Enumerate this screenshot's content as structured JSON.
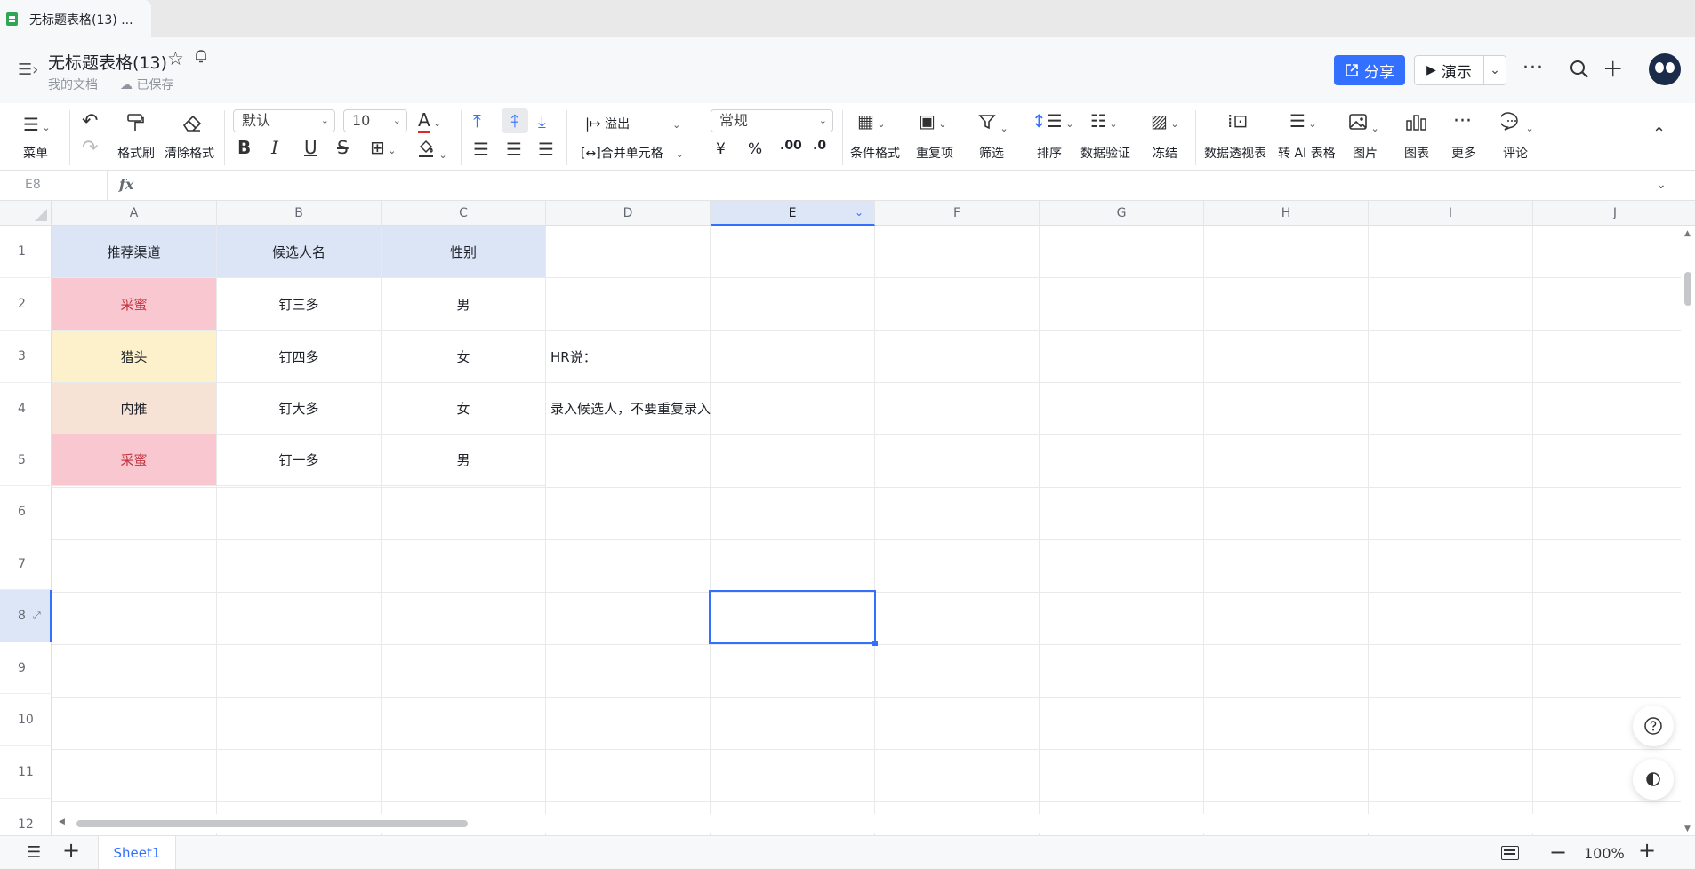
{
  "browser_tab": {
    "title": "无标题表格(13) ..."
  },
  "header": {
    "menu_toggle": "☰›",
    "doc_title": "无标题表格(13)",
    "breadcrumb": "我的文档",
    "save_status": "已保存",
    "share_label": "分享",
    "present_label": "演示",
    "more_label": "···"
  },
  "toolbar": {
    "menu_label": "菜单",
    "format_painter_label": "格式刷",
    "clear_format_label": "清除格式",
    "font_family": "默认",
    "font_size": "10",
    "overflow_label": "溢出",
    "merge_label": "合并单元格",
    "number_format": "常规",
    "currency_symbol": "¥",
    "percent_symbol": "%",
    "decimal_increase": ".00",
    "decimal_decrease": ".0",
    "conditional_format_label": "条件格式",
    "duplicate_label": "重复项",
    "filter_label": "筛选",
    "sort_label": "排序",
    "data_validation_label": "数据验证",
    "freeze_label": "冻结",
    "pivot_label": "数据透视表",
    "ai_table_label": "转 AI 表格",
    "image_label": "图片",
    "chart_label": "图表",
    "more_label": "更多",
    "comment_label": "评论"
  },
  "formula_bar": {
    "cell_ref": "E8",
    "fx_label": "fx",
    "value": ""
  },
  "sheet": {
    "columns": [
      "A",
      "B",
      "C",
      "D",
      "E",
      "F",
      "G",
      "H",
      "I",
      "J"
    ],
    "selected_column": "E",
    "rows": [
      "1",
      "2",
      "3",
      "4",
      "5",
      "6",
      "7",
      "8",
      "9",
      "10",
      "11",
      "12"
    ],
    "selected_row": "8",
    "header_row": [
      "推荐渠道",
      "候选人名",
      "性别"
    ],
    "data": [
      [
        "采蜜",
        "钉三多",
        "男"
      ],
      [
        "猎头",
        "钉四多",
        "女"
      ],
      [
        "内推",
        "钉大多",
        "女"
      ],
      [
        "采蜜",
        "钉一多",
        "男"
      ]
    ],
    "note_d3": "HR说：",
    "note_d4": "录入候选人，不要重复录入",
    "colors": {
      "header_fill": "#dce5f5",
      "caimi_fill": "#f8c7cf",
      "caimi_text": "#c2313d",
      "lietou_fill": "#fdf1cc",
      "neitui_fill": "#f7e2d6",
      "accent": "#3370ff"
    }
  },
  "bottom": {
    "sheet_tab": "Sheet1",
    "zoom": "100%"
  }
}
